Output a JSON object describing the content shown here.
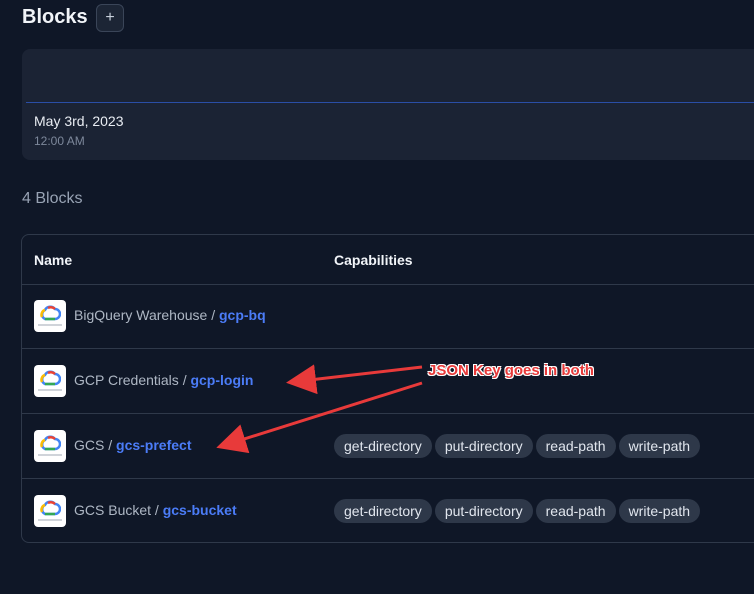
{
  "page": {
    "title": "Blocks",
    "add_label": "+"
  },
  "date_card": {
    "date": "May 3rd, 2023",
    "time": "12:00 AM"
  },
  "blocks_count": "4 Blocks",
  "table": {
    "columns": [
      "Name",
      "Capabilities"
    ],
    "rows": [
      {
        "type": "BigQuery Warehouse",
        "sep": "/",
        "name": "gcp-bq",
        "capabilities": []
      },
      {
        "type": "GCP Credentials",
        "sep": "/",
        "name": "gcp-login",
        "capabilities": []
      },
      {
        "type": "GCS",
        "sep": "/",
        "name": "gcs-prefect",
        "capabilities": [
          "get-directory",
          "put-directory",
          "read-path",
          "write-path"
        ]
      },
      {
        "type": "GCS Bucket",
        "sep": "/",
        "name": "gcs-bucket",
        "capabilities": [
          "get-directory",
          "put-directory",
          "read-path",
          "write-path"
        ]
      }
    ]
  },
  "annotation": {
    "text": "JSON Key goes in both",
    "color": "#e83a3a"
  },
  "icons": {
    "block_logo": "google-cloud-logo-icon",
    "add": "plus-icon"
  }
}
